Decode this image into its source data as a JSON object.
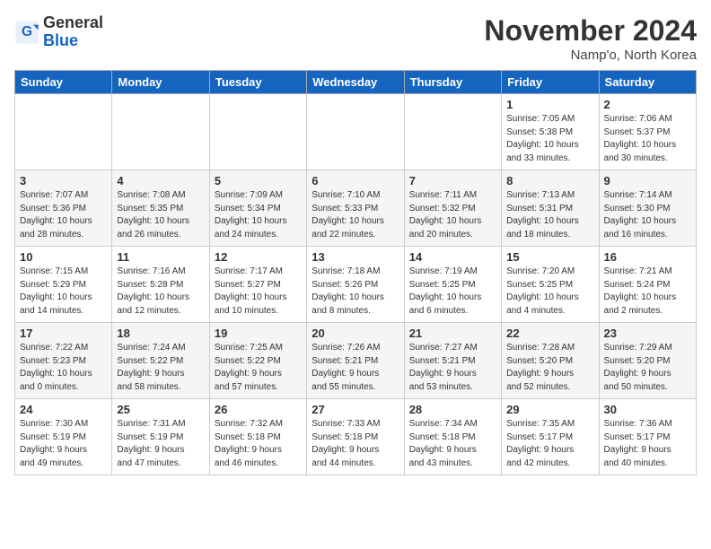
{
  "logo": {
    "general": "General",
    "blue": "Blue"
  },
  "title": "November 2024",
  "subtitle": "Namp'o, North Korea",
  "days_header": [
    "Sunday",
    "Monday",
    "Tuesday",
    "Wednesday",
    "Thursday",
    "Friday",
    "Saturday"
  ],
  "weeks": [
    [
      {
        "day": "",
        "info": ""
      },
      {
        "day": "",
        "info": ""
      },
      {
        "day": "",
        "info": ""
      },
      {
        "day": "",
        "info": ""
      },
      {
        "day": "",
        "info": ""
      },
      {
        "day": "1",
        "info": "Sunrise: 7:05 AM\nSunset: 5:38 PM\nDaylight: 10 hours\nand 33 minutes."
      },
      {
        "day": "2",
        "info": "Sunrise: 7:06 AM\nSunset: 5:37 PM\nDaylight: 10 hours\nand 30 minutes."
      }
    ],
    [
      {
        "day": "3",
        "info": "Sunrise: 7:07 AM\nSunset: 5:36 PM\nDaylight: 10 hours\nand 28 minutes."
      },
      {
        "day": "4",
        "info": "Sunrise: 7:08 AM\nSunset: 5:35 PM\nDaylight: 10 hours\nand 26 minutes."
      },
      {
        "day": "5",
        "info": "Sunrise: 7:09 AM\nSunset: 5:34 PM\nDaylight: 10 hours\nand 24 minutes."
      },
      {
        "day": "6",
        "info": "Sunrise: 7:10 AM\nSunset: 5:33 PM\nDaylight: 10 hours\nand 22 minutes."
      },
      {
        "day": "7",
        "info": "Sunrise: 7:11 AM\nSunset: 5:32 PM\nDaylight: 10 hours\nand 20 minutes."
      },
      {
        "day": "8",
        "info": "Sunrise: 7:13 AM\nSunset: 5:31 PM\nDaylight: 10 hours\nand 18 minutes."
      },
      {
        "day": "9",
        "info": "Sunrise: 7:14 AM\nSunset: 5:30 PM\nDaylight: 10 hours\nand 16 minutes."
      }
    ],
    [
      {
        "day": "10",
        "info": "Sunrise: 7:15 AM\nSunset: 5:29 PM\nDaylight: 10 hours\nand 14 minutes."
      },
      {
        "day": "11",
        "info": "Sunrise: 7:16 AM\nSunset: 5:28 PM\nDaylight: 10 hours\nand 12 minutes."
      },
      {
        "day": "12",
        "info": "Sunrise: 7:17 AM\nSunset: 5:27 PM\nDaylight: 10 hours\nand 10 minutes."
      },
      {
        "day": "13",
        "info": "Sunrise: 7:18 AM\nSunset: 5:26 PM\nDaylight: 10 hours\nand 8 minutes."
      },
      {
        "day": "14",
        "info": "Sunrise: 7:19 AM\nSunset: 5:25 PM\nDaylight: 10 hours\nand 6 minutes."
      },
      {
        "day": "15",
        "info": "Sunrise: 7:20 AM\nSunset: 5:25 PM\nDaylight: 10 hours\nand 4 minutes."
      },
      {
        "day": "16",
        "info": "Sunrise: 7:21 AM\nSunset: 5:24 PM\nDaylight: 10 hours\nand 2 minutes."
      }
    ],
    [
      {
        "day": "17",
        "info": "Sunrise: 7:22 AM\nSunset: 5:23 PM\nDaylight: 10 hours\nand 0 minutes."
      },
      {
        "day": "18",
        "info": "Sunrise: 7:24 AM\nSunset: 5:22 PM\nDaylight: 9 hours\nand 58 minutes."
      },
      {
        "day": "19",
        "info": "Sunrise: 7:25 AM\nSunset: 5:22 PM\nDaylight: 9 hours\nand 57 minutes."
      },
      {
        "day": "20",
        "info": "Sunrise: 7:26 AM\nSunset: 5:21 PM\nDaylight: 9 hours\nand 55 minutes."
      },
      {
        "day": "21",
        "info": "Sunrise: 7:27 AM\nSunset: 5:21 PM\nDaylight: 9 hours\nand 53 minutes."
      },
      {
        "day": "22",
        "info": "Sunrise: 7:28 AM\nSunset: 5:20 PM\nDaylight: 9 hours\nand 52 minutes."
      },
      {
        "day": "23",
        "info": "Sunrise: 7:29 AM\nSunset: 5:20 PM\nDaylight: 9 hours\nand 50 minutes."
      }
    ],
    [
      {
        "day": "24",
        "info": "Sunrise: 7:30 AM\nSunset: 5:19 PM\nDaylight: 9 hours\nand 49 minutes."
      },
      {
        "day": "25",
        "info": "Sunrise: 7:31 AM\nSunset: 5:19 PM\nDaylight: 9 hours\nand 47 minutes."
      },
      {
        "day": "26",
        "info": "Sunrise: 7:32 AM\nSunset: 5:18 PM\nDaylight: 9 hours\nand 46 minutes."
      },
      {
        "day": "27",
        "info": "Sunrise: 7:33 AM\nSunset: 5:18 PM\nDaylight: 9 hours\nand 44 minutes."
      },
      {
        "day": "28",
        "info": "Sunrise: 7:34 AM\nSunset: 5:18 PM\nDaylight: 9 hours\nand 43 minutes."
      },
      {
        "day": "29",
        "info": "Sunrise: 7:35 AM\nSunset: 5:17 PM\nDaylight: 9 hours\nand 42 minutes."
      },
      {
        "day": "30",
        "info": "Sunrise: 7:36 AM\nSunset: 5:17 PM\nDaylight: 9 hours\nand 40 minutes."
      }
    ]
  ]
}
